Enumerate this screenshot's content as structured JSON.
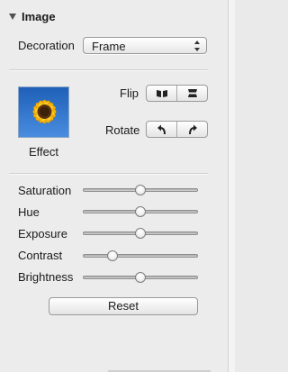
{
  "section": {
    "title": "Image",
    "expanded": true
  },
  "decoration": {
    "label": "Decoration",
    "selected": "Frame"
  },
  "effect": {
    "label": "Effect",
    "thumbnail": "sunflower-image"
  },
  "flip": {
    "label": "Flip",
    "buttons": [
      "flip-horizontal-icon",
      "flip-vertical-icon"
    ]
  },
  "rotate": {
    "label": "Rotate",
    "buttons": [
      "rotate-left-icon",
      "rotate-right-icon"
    ]
  },
  "sliders": [
    {
      "label": "Saturation",
      "value": 0.5
    },
    {
      "label": "Hue",
      "value": 0.5
    },
    {
      "label": "Exposure",
      "value": 0.5
    },
    {
      "label": "Contrast",
      "value": 0.23
    },
    {
      "label": "Brightness",
      "value": 0.5
    }
  ],
  "reset_label": "Reset"
}
